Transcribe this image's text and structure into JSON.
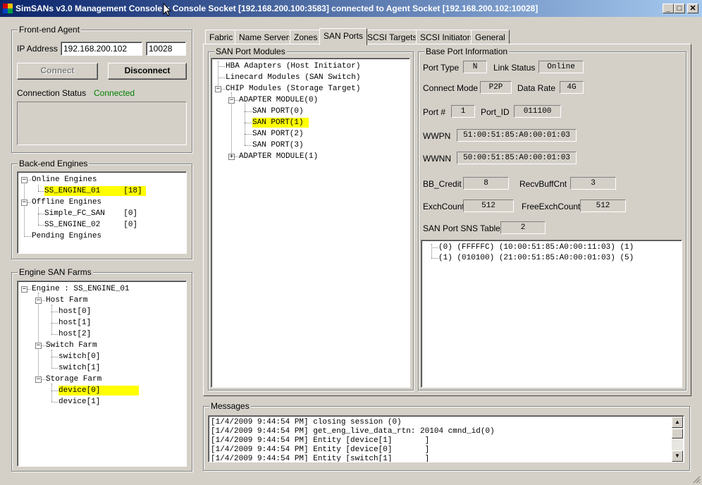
{
  "window": {
    "title": "SimSANs v3.0 Management Console :: Console Socket [192.168.200.100:3583] connected to Agent Socket [192.168.200.102:10028]",
    "minimize_glyph": "_",
    "maximize_glyph": "□",
    "close_glyph": "✕"
  },
  "frontend": {
    "group_label": "Front-end Agent",
    "ip_label": "IP Address",
    "ip_value": "192.168.200.102",
    "port_value": "10028",
    "connect_label": "Connect",
    "disconnect_label": "Disconnect",
    "status_label": "Connection Status",
    "status_value": "Connected",
    "status_color": "#008000"
  },
  "backend": {
    "group_label": "Back-end Engines",
    "nodes": [
      "Online Engines",
      "SS_ENGINE_01     [18]",
      "Offline Engines",
      "Simple_FC_SAN    [0]",
      "SS_ENGINE_02     [0]",
      "Pending Engines"
    ],
    "expander_minus": "−"
  },
  "farms": {
    "group_label": "Engine SAN Farms",
    "nodes": [
      "Engine : SS_ENGINE_01",
      "Host Farm",
      "host[0]",
      "host[1]",
      "host[2]",
      "Switch Farm",
      "switch[0]",
      "switch[1]",
      "Storage Farm",
      "device[0]",
      "device[1]"
    ]
  },
  "tabs": [
    "Fabric",
    "Name Servers",
    "Zones",
    "SAN Ports",
    "SCSI Targets",
    "SCSI Initiators",
    "General"
  ],
  "active_tab": "SAN Ports",
  "port_modules": {
    "group_label": "SAN Port Modules",
    "nodes": [
      "HBA Adapters (Host Initiator)",
      "Linecard Modules (SAN Switch)",
      "CHIP Modules (Storage Target)",
      "ADAPTER MODULE(0)",
      "SAN PORT(0)",
      "SAN PORT(1)",
      "SAN PORT(2)",
      "SAN PORT(3)",
      "ADAPTER MODULE(1)"
    ],
    "plus": "+",
    "minus": "−"
  },
  "base_port": {
    "group_label": "Base Port Information",
    "port_type_label": "Port Type",
    "port_type": "N",
    "link_status_label": "Link Status",
    "link_status": "Online",
    "connect_mode_label": "Connect Mode",
    "connect_mode": "P2P",
    "data_rate_label": "Data Rate",
    "data_rate": "4G",
    "port_num_label": "Port #",
    "port_num": "1",
    "port_id_label": "Port_ID",
    "port_id": "011100",
    "wwpn_label": "WWPN",
    "wwpn": "51:00:51:85:A0:00:01:03",
    "wwnn_label": "WWNN",
    "wwnn": "50:00:51:85:A0:00:01:03",
    "bb_credit_label": "BB_Credit",
    "bb_credit": "8",
    "recv_buff_label": "RecvBuffCnt",
    "recv_buff": "3",
    "exch_count_label": "ExchCount",
    "exch_count": "512",
    "free_exch_label": "FreeExchCount",
    "free_exch": "512",
    "sns_table_label": "SAN Port SNS Table",
    "sns_table_count": "2",
    "sns_entries": [
      "(0) (FFFFFC) (10:00:51:85:A0:00:11:03) (1)",
      "(1) (010100) (21:00:51:85:A0:00:01:03) (5)"
    ]
  },
  "messages": {
    "group_label": "Messages",
    "lines": [
      "[1/4/2009 9:44:54 PM] closing session (0)",
      "[1/4/2009 9:44:54 PM] get_eng_live_data_rtn: 20104 cmnd_id(0)",
      "[1/4/2009 9:44:54 PM] Entity [device[1]       ]",
      "[1/4/2009 9:44:54 PM] Entity [device[0]       ]",
      "[1/4/2009 9:44:54 PM] Entity [switch[1]       ]"
    ],
    "scroll_up": "▲",
    "scroll_down": "▼"
  },
  "colors": {
    "highlight": "#ffff00",
    "face": "#d4d0c8",
    "titlebar_start": "#0a246a",
    "titlebar_end": "#a6caf0"
  }
}
